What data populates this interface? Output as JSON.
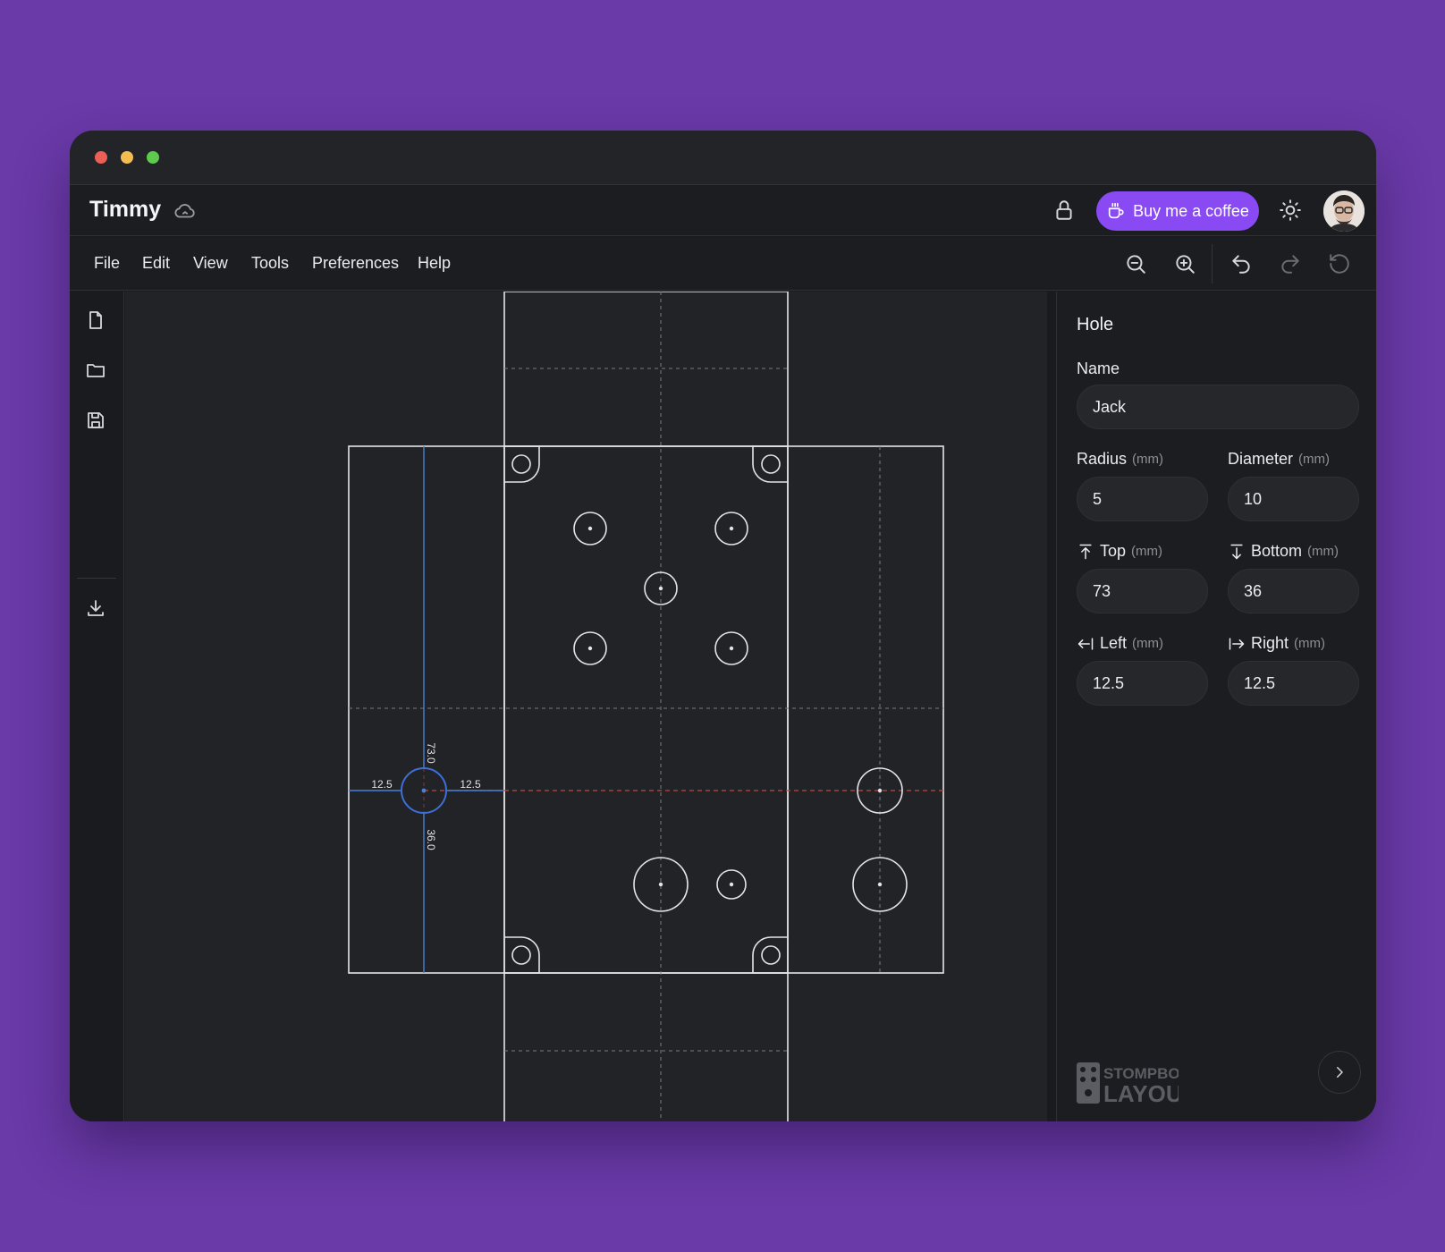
{
  "app": {
    "title": "Timmy",
    "coffee_label": "Buy me a coffee"
  },
  "menu": [
    "File",
    "Edit",
    "View",
    "Tools",
    "Preferences",
    "Help"
  ],
  "toolbar_icons": [
    "zoom-out-icon",
    "zoom-in-icon",
    "undo-icon",
    "redo-icon",
    "reset-icon"
  ],
  "left_sidebar_icons": [
    "new-file-icon",
    "open-folder-icon",
    "save-icon",
    "download-icon"
  ],
  "canvas": {
    "dimensions": {
      "left": "12.5",
      "right": "12.5",
      "top": "73.0",
      "bottom": "36.0"
    }
  },
  "panel": {
    "title": "Hole",
    "name_label": "Name",
    "name_value": "Jack",
    "unit": "(mm)",
    "radius_label": "Radius",
    "radius_value": "5",
    "diameter_label": "Diameter",
    "diameter_value": "10",
    "top_label": "Top",
    "top_value": "73",
    "bottom_label": "Bottom",
    "bottom_value": "36",
    "left_label": "Left",
    "left_value": "12.5",
    "right_label": "Right",
    "right_value": "12.5"
  },
  "logo": {
    "line1": "STOMPBOX",
    "line2": "LAYOUT"
  },
  "colors": {
    "accent": "#8a4af3",
    "selection_blue": "#3d6fd6",
    "guide_red": "#c0473f",
    "background_purple": "#6a3aa8"
  }
}
